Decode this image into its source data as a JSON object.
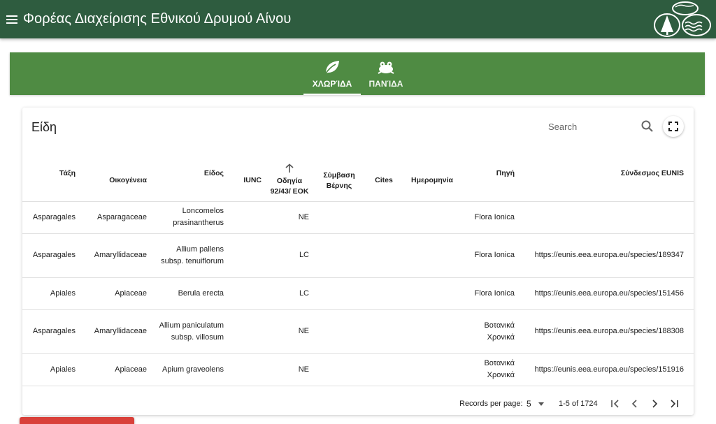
{
  "appbar": {
    "title": "Φορέας Διαχείρισης Εθνικού Δρυμού Αίνου",
    "accent": "#2e5c3f"
  },
  "tabs": [
    {
      "label": "ΧΛΩΡΊΔΑ",
      "icon": "leaf-icon",
      "active": true
    },
    {
      "label": "ΠΑΝΊΔΑ",
      "icon": "frog-icon",
      "active": false
    }
  ],
  "tab_band_color": "#4f8b43",
  "card": {
    "title": "Είδη",
    "search_placeholder": "Search"
  },
  "table": {
    "headers": {
      "order": "Τάξη",
      "family": "Οικογένεια",
      "species": "Είδος",
      "iunc": "IUNC",
      "directive": "Οδηγία 92/43/ ΕΟΚ",
      "bern": "Σύμβαση Βέρνης",
      "cites": "Cites",
      "date": "Ημερομηνία",
      "source": "Πηγή",
      "eunis": "Σύνδεσμος EUNIS"
    },
    "sorted_column": "directive",
    "rows": [
      {
        "order": "Asparagales",
        "family": "Asparagaceae",
        "species": "Loncomelos prasinantherus",
        "iunc": "",
        "directive": "NE",
        "bern": "",
        "cites": "",
        "date": "",
        "source": "Flora Ionica",
        "eunis": ""
      },
      {
        "order": "Asparagales",
        "family": "Amaryllidaceae",
        "species": "Allium pallens subsp. tenuiflorum",
        "iunc": "",
        "directive": "LC",
        "bern": "",
        "cites": "",
        "date": "",
        "source": "Flora Ionica",
        "eunis": "https://eunis.eea.europa.eu/species/189347"
      },
      {
        "order": "Apiales",
        "family": "Apiaceae",
        "species": "Berula erecta",
        "iunc": "",
        "directive": "LC",
        "bern": "",
        "cites": "",
        "date": "",
        "source": "Flora Ionica",
        "eunis": "https://eunis.eea.europa.eu/species/151456"
      },
      {
        "order": "Asparagales",
        "family": "Amaryllidaceae",
        "species": "Allium paniculatum subsp. villosum",
        "iunc": "",
        "directive": "NE",
        "bern": "",
        "cites": "",
        "date": "",
        "source": "Βοτανικά Χρονικά",
        "eunis": "https://eunis.eea.europa.eu/species/188308"
      },
      {
        "order": "Apiales",
        "family": "Apiaceae",
        "species": "Apium graveolens",
        "iunc": "",
        "directive": "NE",
        "bern": "",
        "cites": "",
        "date": "",
        "source": "Βοτανικά Χρονικά",
        "eunis": "https://eunis.eea.europa.eu/species/151916"
      }
    ]
  },
  "pager": {
    "records_label": "Records per page:",
    "per_page": "5",
    "range": "1-5 of 1724"
  }
}
